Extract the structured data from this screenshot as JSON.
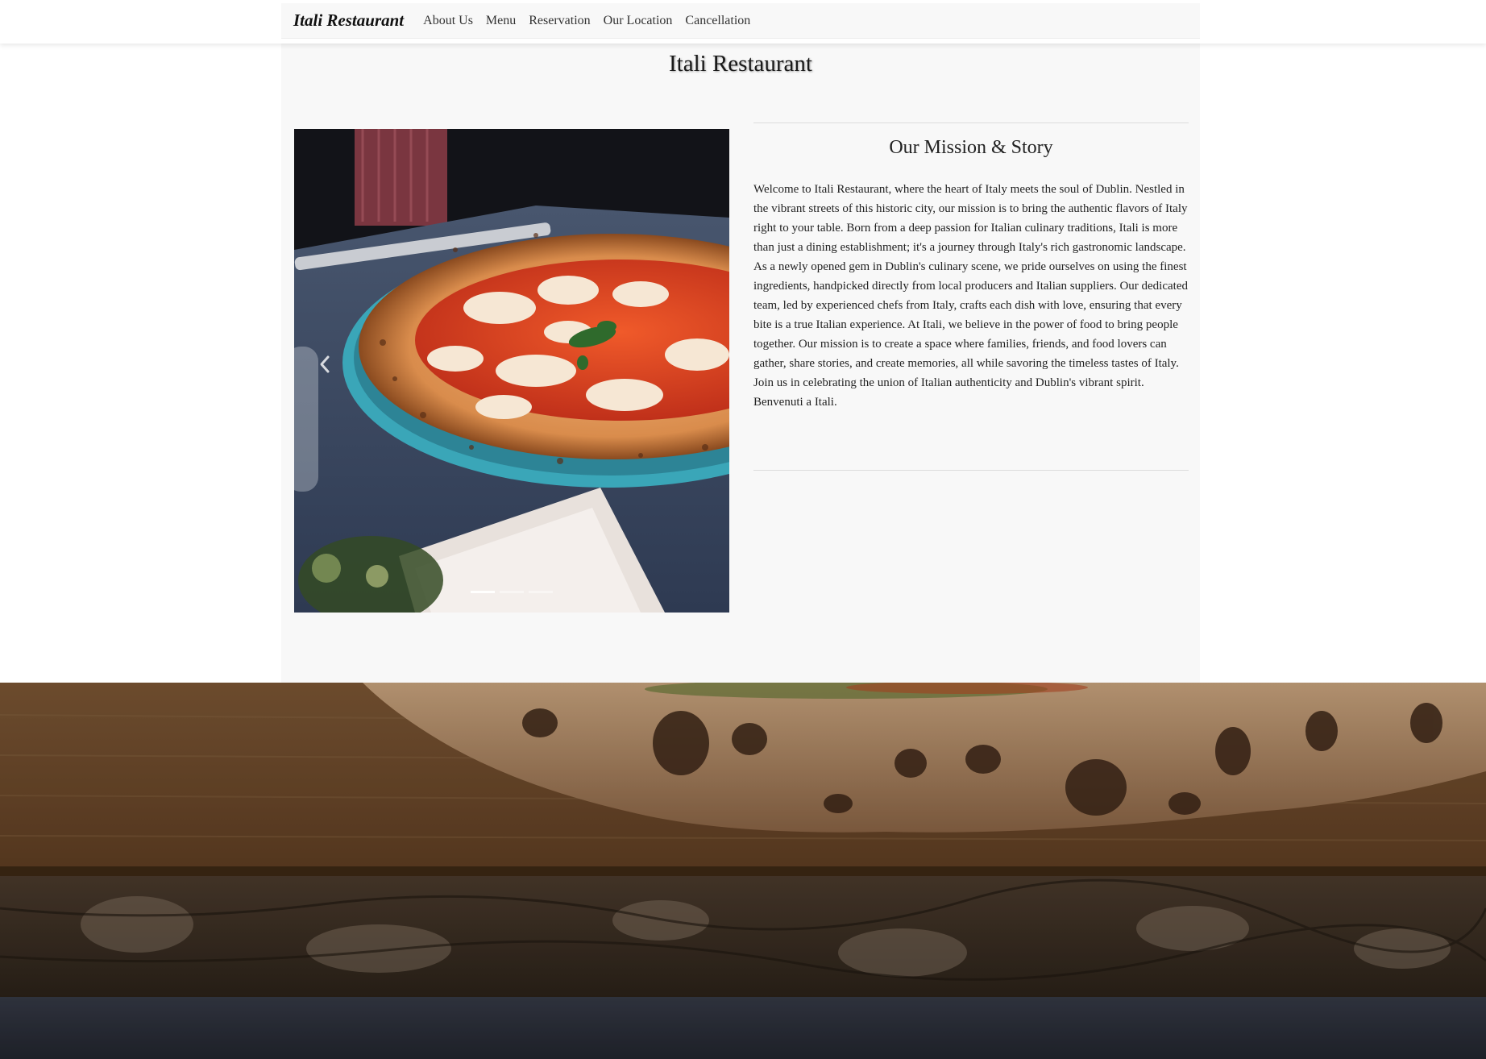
{
  "navbar": {
    "brand": "Itali Restaurant",
    "links": [
      "About Us",
      "Menu",
      "Reservation",
      "Our Location",
      "Cancellation"
    ]
  },
  "page": {
    "title": "Itali Restaurant"
  },
  "carousel": {
    "image_subject": "pizza-margherita-photo",
    "slide_count": 3,
    "active_slide": 1,
    "prev_icon": "chevron-left-icon"
  },
  "mission": {
    "title": "Our Mission & Story",
    "text": "Welcome to Itali Restaurant, where the heart of Italy meets the soul of Dublin. Nestled in the vibrant streets of this historic city, our mission is to bring the authentic flavors of Italy right to your table. Born from a deep passion for Italian culinary traditions, Itali is more than just a dining establishment; it's a journey through Italy's rich gastronomic landscape. As a newly opened gem in Dublin's culinary scene, we pride ourselves on using the finest ingredients, handpicked directly from local producers and Italian suppliers. Our dedicated team, led by experienced chefs from Italy, crafts each dish with love, ensuring that every bite is a true Italian experience. At Itali, we believe in the power of food to bring people together. Our mission is to create a space where families, friends, and food lovers can gather, share stories, and create memories, all while savoring the timeless tastes of Italy. Join us in celebrating the union of Italian authenticity and Dublin's vibrant spirit. Benvenuti a Itali."
  },
  "hero": {
    "image_subject": "pizza-crust-on-wooden-board-photo"
  },
  "colors": {
    "navbar_bg": "#f8f8f8",
    "container_bg": "#f8f8f8",
    "text": "#222222"
  }
}
